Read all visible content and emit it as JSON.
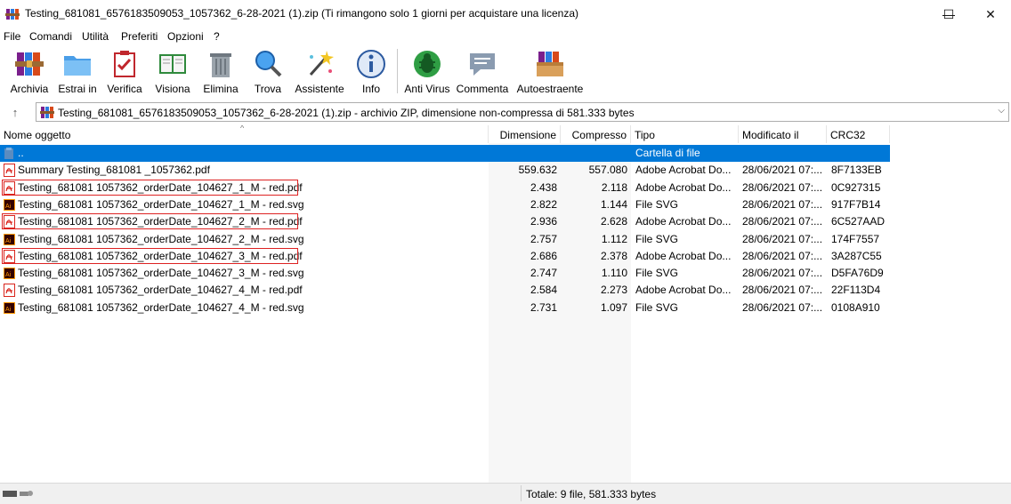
{
  "window": {
    "title": "Testing_681081_6576183509053_1057362_6-28-2021 (1).zip (Ti rimangono solo 1 giorni per acquistare una licenza)",
    "minimize_glyph": "—",
    "maximize_glyph": "☐",
    "close_glyph": "✕"
  },
  "menu": {
    "items": [
      "File",
      "Comandi",
      "Utilità",
      "Preferiti",
      "Opzioni",
      "?"
    ]
  },
  "toolbar": {
    "buttons": [
      {
        "label": "Archivia",
        "icon": "archive-books-icon"
      },
      {
        "label": "Estrai in",
        "icon": "extract-folder-icon"
      },
      {
        "label": "Verifica",
        "icon": "test-clipboard-icon"
      },
      {
        "label": "Visiona",
        "icon": "view-book-icon"
      },
      {
        "label": "Elimina",
        "icon": "trash-icon"
      },
      {
        "label": "Trova",
        "icon": "magnifier-icon"
      },
      {
        "label": "Assistente",
        "icon": "wizard-wand-icon"
      },
      {
        "label": "Info",
        "icon": "info-icon"
      },
      {
        "label": "Anti Virus",
        "icon": "antivirus-bug-icon"
      },
      {
        "label": "Commenta",
        "icon": "comment-icon"
      },
      {
        "label": "Autoestraente",
        "icon": "sfx-box-icon"
      }
    ]
  },
  "address": {
    "up_glyph": "↑",
    "text": "Testing_681081_6576183509053_1057362_6-28-2021 (1).zip - archivio ZIP, dimensione non-compressa di 581.333 bytes",
    "drop_glyph": "⌵"
  },
  "columns": {
    "name": "Nome oggetto",
    "size": "Dimensione",
    "packed": "Compresso",
    "type": "Tipo",
    "modified": "Modificato il",
    "crc": "CRC32"
  },
  "files": [
    {
      "name": "..",
      "size": "",
      "packed": "",
      "type": "Cartella di file",
      "modified": "",
      "crc": "",
      "icon": "folder-icon",
      "selected": true,
      "highlighted": false
    },
    {
      "name": "Summary Testing_681081 _1057362.pdf",
      "size": "559.632",
      "packed": "557.080",
      "type": "Adobe Acrobat Do...",
      "modified": "28/06/2021 07:...",
      "crc": "8F7133EB",
      "icon": "pdf-icon",
      "selected": false,
      "highlighted": false
    },
    {
      "name": "Testing_681081  1057362_orderDate_104627_1_M - red.pdf",
      "size": "2.438",
      "packed": "2.118",
      "type": "Adobe Acrobat Do...",
      "modified": "28/06/2021 07:...",
      "crc": "0C927315",
      "icon": "pdf-icon",
      "selected": false,
      "highlighted": true
    },
    {
      "name": "Testing_681081  1057362_orderDate_104627_1_M - red.svg",
      "size": "2.822",
      "packed": "1.144",
      "type": "File SVG",
      "modified": "28/06/2021 07:...",
      "crc": "917F7B14",
      "icon": "illustrator-icon",
      "selected": false,
      "highlighted": false
    },
    {
      "name": "Testing_681081  1057362_orderDate_104627_2_M - red.pdf",
      "size": "2.936",
      "packed": "2.628",
      "type": "Adobe Acrobat Do...",
      "modified": "28/06/2021 07:...",
      "crc": "6C527AAD",
      "icon": "pdf-icon",
      "selected": false,
      "highlighted": true
    },
    {
      "name": "Testing_681081  1057362_orderDate_104627_2_M - red.svg",
      "size": "2.757",
      "packed": "1.112",
      "type": "File SVG",
      "modified": "28/06/2021 07:...",
      "crc": "174F7557",
      "icon": "illustrator-icon",
      "selected": false,
      "highlighted": false
    },
    {
      "name": "Testing_681081  1057362_orderDate_104627_3_M - red.pdf",
      "size": "2.686",
      "packed": "2.378",
      "type": "Adobe Acrobat Do...",
      "modified": "28/06/2021 07:...",
      "crc": "3A287C55",
      "icon": "pdf-icon",
      "selected": false,
      "highlighted": true
    },
    {
      "name": "Testing_681081  1057362_orderDate_104627_3_M - red.svg",
      "size": "2.747",
      "packed": "1.110",
      "type": "File SVG",
      "modified": "28/06/2021 07:...",
      "crc": "D5FA76D9",
      "icon": "illustrator-icon",
      "selected": false,
      "highlighted": false
    },
    {
      "name": "Testing_681081  1057362_orderDate_104627_4_M - red.pdf",
      "size": "2.584",
      "packed": "2.273",
      "type": "Adobe Acrobat Do...",
      "modified": "28/06/2021 07:...",
      "crc": "22F113D4",
      "icon": "pdf-icon",
      "selected": false,
      "highlighted": false
    },
    {
      "name": "Testing_681081  1057362_orderDate_104627_4_M - red.svg",
      "size": "2.731",
      "packed": "1.097",
      "type": "File SVG",
      "modified": "28/06/2021 07:...",
      "crc": "0108A910",
      "icon": "illustrator-icon",
      "selected": false,
      "highlighted": false
    }
  ],
  "status": {
    "text": "Totale: 9 file, 581.333 bytes",
    "icons": [
      "keyboard-icon",
      "drive-key-icon"
    ]
  },
  "colors": {
    "selection": "#0078d7",
    "highlight_border": "#dd2222",
    "pdf_red": "#d9251d",
    "illustrator_orange": "#ff9a00",
    "illustrator_bg": "#330000"
  }
}
